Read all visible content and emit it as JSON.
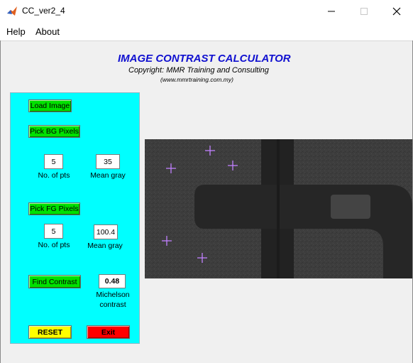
{
  "window": {
    "title": "CC_ver2_4"
  },
  "menubar": {
    "items": [
      "Help",
      "About"
    ]
  },
  "header": {
    "title": "IMAGE CONTRAST CALCULATOR",
    "copyright": "Copyright: MMR Training and Consulting",
    "website": "(www.mmrtraining.com.my)"
  },
  "panel": {
    "load_image_label": "Load Image",
    "pick_bg_label": "Pick BG Pixels",
    "bg_points": "5",
    "bg_points_label": "No. of pts",
    "bg_mean": "35",
    "bg_mean_label": "Mean gray",
    "pick_fg_label": "Pick FG Pixels",
    "fg_points": "5",
    "fg_points_label": "No. of pts",
    "fg_mean": "100.4",
    "fg_mean_label": "Mean gray",
    "find_contrast_label": "Find Contrast",
    "contrast_value": "0.48",
    "contrast_label_line1": "Michelson",
    "contrast_label_line2": "contrast",
    "reset_label": "RESET",
    "exit_label": "Exit"
  },
  "colors": {
    "panel_bg": "#00ffff",
    "green_button": "#00e000",
    "reset_button": "#ffff00",
    "exit_button": "#ff0000",
    "title_blue": "#1010d0",
    "marker_color": "#c080ff"
  }
}
